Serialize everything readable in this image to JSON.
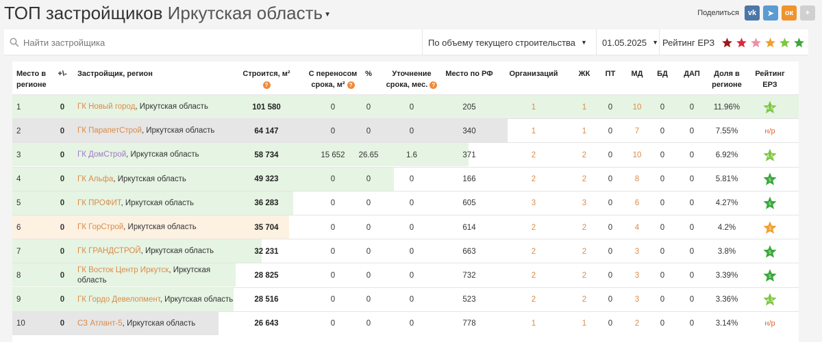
{
  "header": {
    "title": "ТОП застройщиков",
    "region": "Иркутская область",
    "share_label": "Поделиться",
    "social": [
      {
        "name": "vk-icon",
        "glyph": "vk",
        "color": "#4a76a8"
      },
      {
        "name": "telegram-icon",
        "glyph": "➤",
        "color": "#5b9bd0"
      },
      {
        "name": "odnoklassniki-icon",
        "glyph": "ок",
        "color": "#f0932c"
      },
      {
        "name": "plus-icon",
        "glyph": "+",
        "color": "#d0d0d0"
      }
    ]
  },
  "toolbar": {
    "search_placeholder": "Найти застройщика",
    "sort_value": "По объему текущего строительства",
    "date_value": "01.05.2025",
    "rating_label": "Рейтинг ЕРЗ",
    "rating_stars": [
      "#a01818",
      "#e0283c",
      "#f28fa8",
      "#f0a030",
      "#7cc840",
      "#3aa83a"
    ]
  },
  "columns": {
    "place": "Место в регионе",
    "delta": "+\\-",
    "developer": "Застройщик, регион",
    "building": "Строится, м²",
    "postponed": "С переносом срока, м²",
    "percent": "%",
    "clarify": "Уточнение срока, мес.",
    "rf_place": "Место по РФ",
    "orgs": "Организаций",
    "zhk": "ЖК",
    "pt": "ПТ",
    "md": "МД",
    "bd": "БД",
    "dap": "ДАП",
    "share": "Доля в регионе",
    "rating": "Рейтинг ЕРЗ"
  },
  "rows": [
    {
      "place": "1",
      "delta": "0",
      "dev": "ГК Новый город",
      "region": ", Иркутская область",
      "violet": false,
      "building": "101 580",
      "postponed": "0",
      "percent": "0",
      "clarify": "0",
      "rf": "205",
      "orgs": "1",
      "zhk": "1",
      "pt": "0",
      "md": "10",
      "bd": "0",
      "dap": "0",
      "share": "11.96%",
      "rating": "4.5",
      "star_color": "#7cc840",
      "bar_pct": 100,
      "bar_color": "#e6f4e3"
    },
    {
      "place": "2",
      "delta": "0",
      "dev": "ГК ПарапетСтрой",
      "region": ", Иркутская область",
      "violet": false,
      "building": "64 147",
      "postponed": "0",
      "percent": "0",
      "clarify": "0",
      "rf": "340",
      "orgs": "1",
      "zhk": "1",
      "pt": "0",
      "md": "7",
      "bd": "0",
      "dap": "0",
      "share": "7.55%",
      "rating": "н/р",
      "star_color": "",
      "bar_pct": 63,
      "bar_color": "#e6e6e6"
    },
    {
      "place": "3",
      "delta": "0",
      "dev": "ГК ДомСтрой",
      "region": ", Иркутская область",
      "violet": true,
      "building": "58 734",
      "postponed": "15 652",
      "percent": "26.65",
      "clarify": "1.6",
      "rf": "371",
      "orgs": "2",
      "zhk": "2",
      "pt": "0",
      "md": "10",
      "bd": "0",
      "dap": "0",
      "share": "6.92%",
      "rating": "4.5",
      "star_color": "#7cc840",
      "bar_pct": 58,
      "bar_color": "#e6f4e3"
    },
    {
      "place": "4",
      "delta": "0",
      "dev": "ГК Альфа",
      "region": ", Иркутская область",
      "violet": false,
      "building": "49 323",
      "postponed": "0",
      "percent": "0",
      "clarify": "0",
      "rf": "166",
      "orgs": "2",
      "zhk": "2",
      "pt": "0",
      "md": "8",
      "bd": "0",
      "dap": "0",
      "share": "5.81%",
      "rating": "5",
      "star_color": "#3aa83a",
      "bar_pct": 48.5,
      "bar_color": "#e6f4e3"
    },
    {
      "place": "5",
      "delta": "0",
      "dev": "ГК ПРОФИТ",
      "region": ", Иркутская область",
      "violet": false,
      "building": "36 283",
      "postponed": "0",
      "percent": "0",
      "clarify": "0",
      "rf": "605",
      "orgs": "3",
      "zhk": "3",
      "pt": "0",
      "md": "6",
      "bd": "0",
      "dap": "0",
      "share": "4.27%",
      "rating": "5",
      "star_color": "#3aa83a",
      "bar_pct": 35.7,
      "bar_color": "#e6f4e3"
    },
    {
      "place": "6",
      "delta": "0",
      "dev": "ГК ГорСтрой",
      "region": ", Иркутская область",
      "violet": false,
      "building": "35 704",
      "postponed": "0",
      "percent": "0",
      "clarify": "0",
      "rf": "614",
      "orgs": "2",
      "zhk": "2",
      "pt": "0",
      "md": "4",
      "bd": "0",
      "dap": "0",
      "share": "4.2%",
      "rating": "3",
      "star_color": "#f0a030",
      "bar_pct": 35.2,
      "bar_color": "#fdf1e2"
    },
    {
      "place": "7",
      "delta": "0",
      "dev": "ГК ГРАНДСТРОЙ",
      "region": ", Иркутская область",
      "violet": false,
      "building": "32 231",
      "postponed": "0",
      "percent": "0",
      "clarify": "0",
      "rf": "663",
      "orgs": "2",
      "zhk": "2",
      "pt": "0",
      "md": "3",
      "bd": "0",
      "dap": "0",
      "share": "3.8%",
      "rating": "5",
      "star_color": "#3aa83a",
      "bar_pct": 31.7,
      "bar_color": "#e6f4e3"
    },
    {
      "place": "8",
      "delta": "0",
      "dev": "ГК Восток Центр Иркутск",
      "region": ", Иркутская область",
      "violet": false,
      "building": "28 825",
      "postponed": "0",
      "percent": "0",
      "clarify": "0",
      "rf": "732",
      "orgs": "2",
      "zhk": "2",
      "pt": "0",
      "md": "3",
      "bd": "0",
      "dap": "0",
      "share": "3.39%",
      "rating": "5",
      "star_color": "#3aa83a",
      "bar_pct": 28.4,
      "bar_color": "#e6f4e3"
    },
    {
      "place": "9",
      "delta": "0",
      "dev": "ГК Гордо Девелопмент",
      "region": ", Иркутская область",
      "violet": false,
      "building": "28 516",
      "postponed": "0",
      "percent": "0",
      "clarify": "0",
      "rf": "523",
      "orgs": "2",
      "zhk": "2",
      "pt": "0",
      "md": "3",
      "bd": "0",
      "dap": "0",
      "share": "3.36%",
      "rating": "4.5",
      "star_color": "#7cc840",
      "bar_pct": 28.1,
      "bar_color": "#e6f4e3"
    },
    {
      "place": "10",
      "delta": "0",
      "dev": "СЗ Атлант-5",
      "region": ", Иркутская область",
      "violet": false,
      "building": "26 643",
      "postponed": "0",
      "percent": "0",
      "clarify": "0",
      "rf": "778",
      "orgs": "1",
      "zhk": "1",
      "pt": "0",
      "md": "2",
      "bd": "0",
      "dap": "0",
      "share": "3.14%",
      "rating": "н/р",
      "star_color": "",
      "bar_pct": 26.2,
      "bar_color": "#e6e6e6"
    }
  ]
}
